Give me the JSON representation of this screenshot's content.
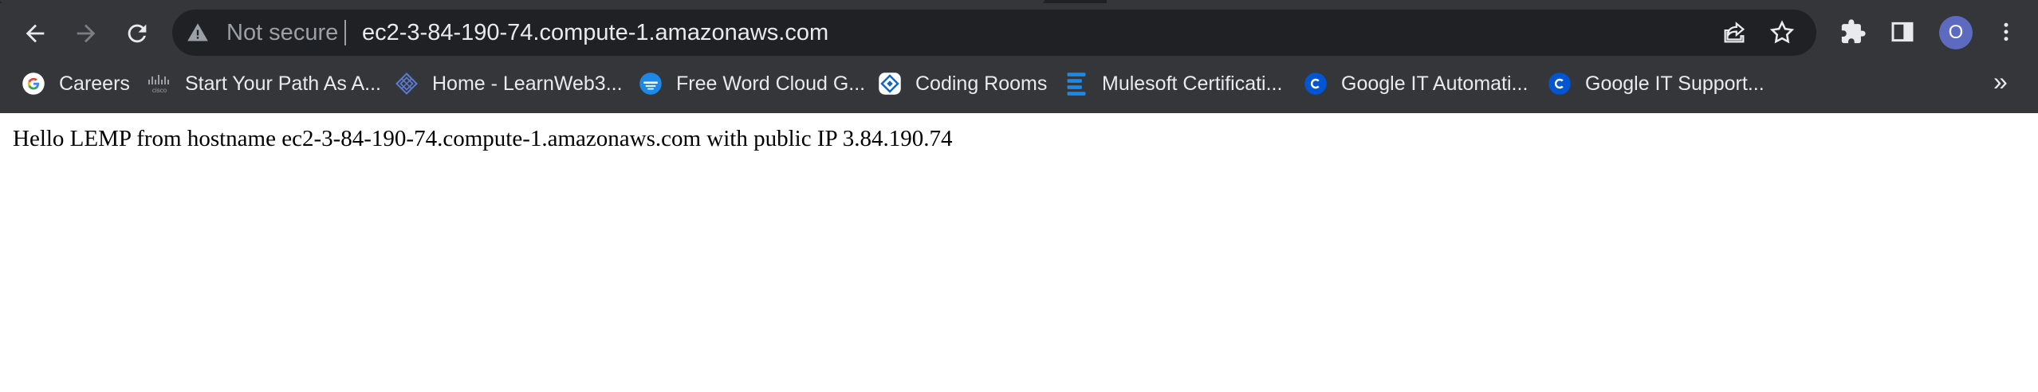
{
  "browser": {
    "omnibox": {
      "security_label": "Not secure",
      "url": "ec2-3-84-190-74.compute-1.amazonaws.com"
    },
    "profile_initial": "O",
    "accent_color": "#5c6bc0",
    "icons": {
      "back": "back-arrow-icon",
      "forward": "forward-arrow-icon",
      "reload": "reload-icon",
      "warning": "warning-icon",
      "share": "share-icon",
      "bookmark": "star-icon",
      "extensions": "puzzle-icon",
      "side_panel": "side-panel-icon",
      "menu": "kebab-menu-icon"
    }
  },
  "bookmarks": {
    "items": [
      {
        "label": "Careers",
        "icon": "google-icon"
      },
      {
        "label": "Start Your Path As A...",
        "icon": "cisco-icon"
      },
      {
        "label": "Home - LearnWeb3...",
        "icon": "learnweb3-icon"
      },
      {
        "label": "Free Word Cloud G...",
        "icon": "wordcloud-icon"
      },
      {
        "label": "Coding Rooms",
        "icon": "coding-rooms-icon"
      },
      {
        "label": "Mulesoft Certificati...",
        "icon": "mulesoft-icon"
      },
      {
        "label": "Google IT Automati...",
        "icon": "coursera-icon"
      },
      {
        "label": "Google IT Support...",
        "icon": "coursera-icon"
      }
    ],
    "overflow": "»"
  },
  "page": {
    "body_text": "Hello LEMP from hostname ec2-3-84-190-74.compute-1.amazonaws.com with public IP 3.84.190.74"
  }
}
